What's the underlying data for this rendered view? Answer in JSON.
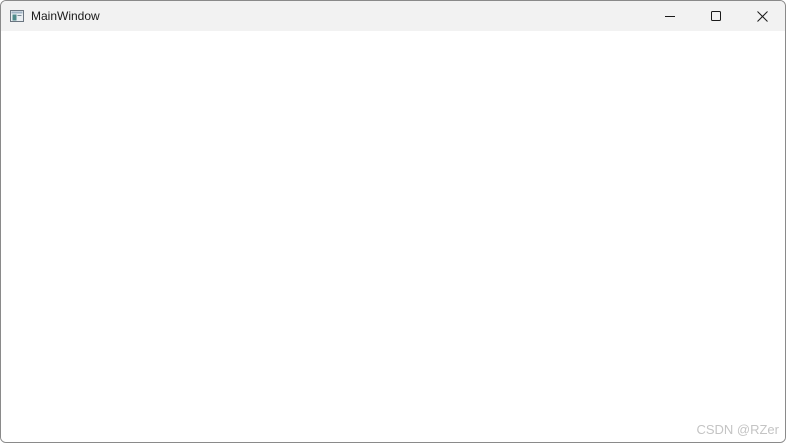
{
  "window": {
    "title": "MainWindow",
    "app_icon": "window-app-icon",
    "controls": {
      "minimize_icon": "minimize-icon",
      "maximize_icon": "maximize-icon",
      "close_icon": "close-icon"
    }
  },
  "watermark": "CSDN @RZer"
}
